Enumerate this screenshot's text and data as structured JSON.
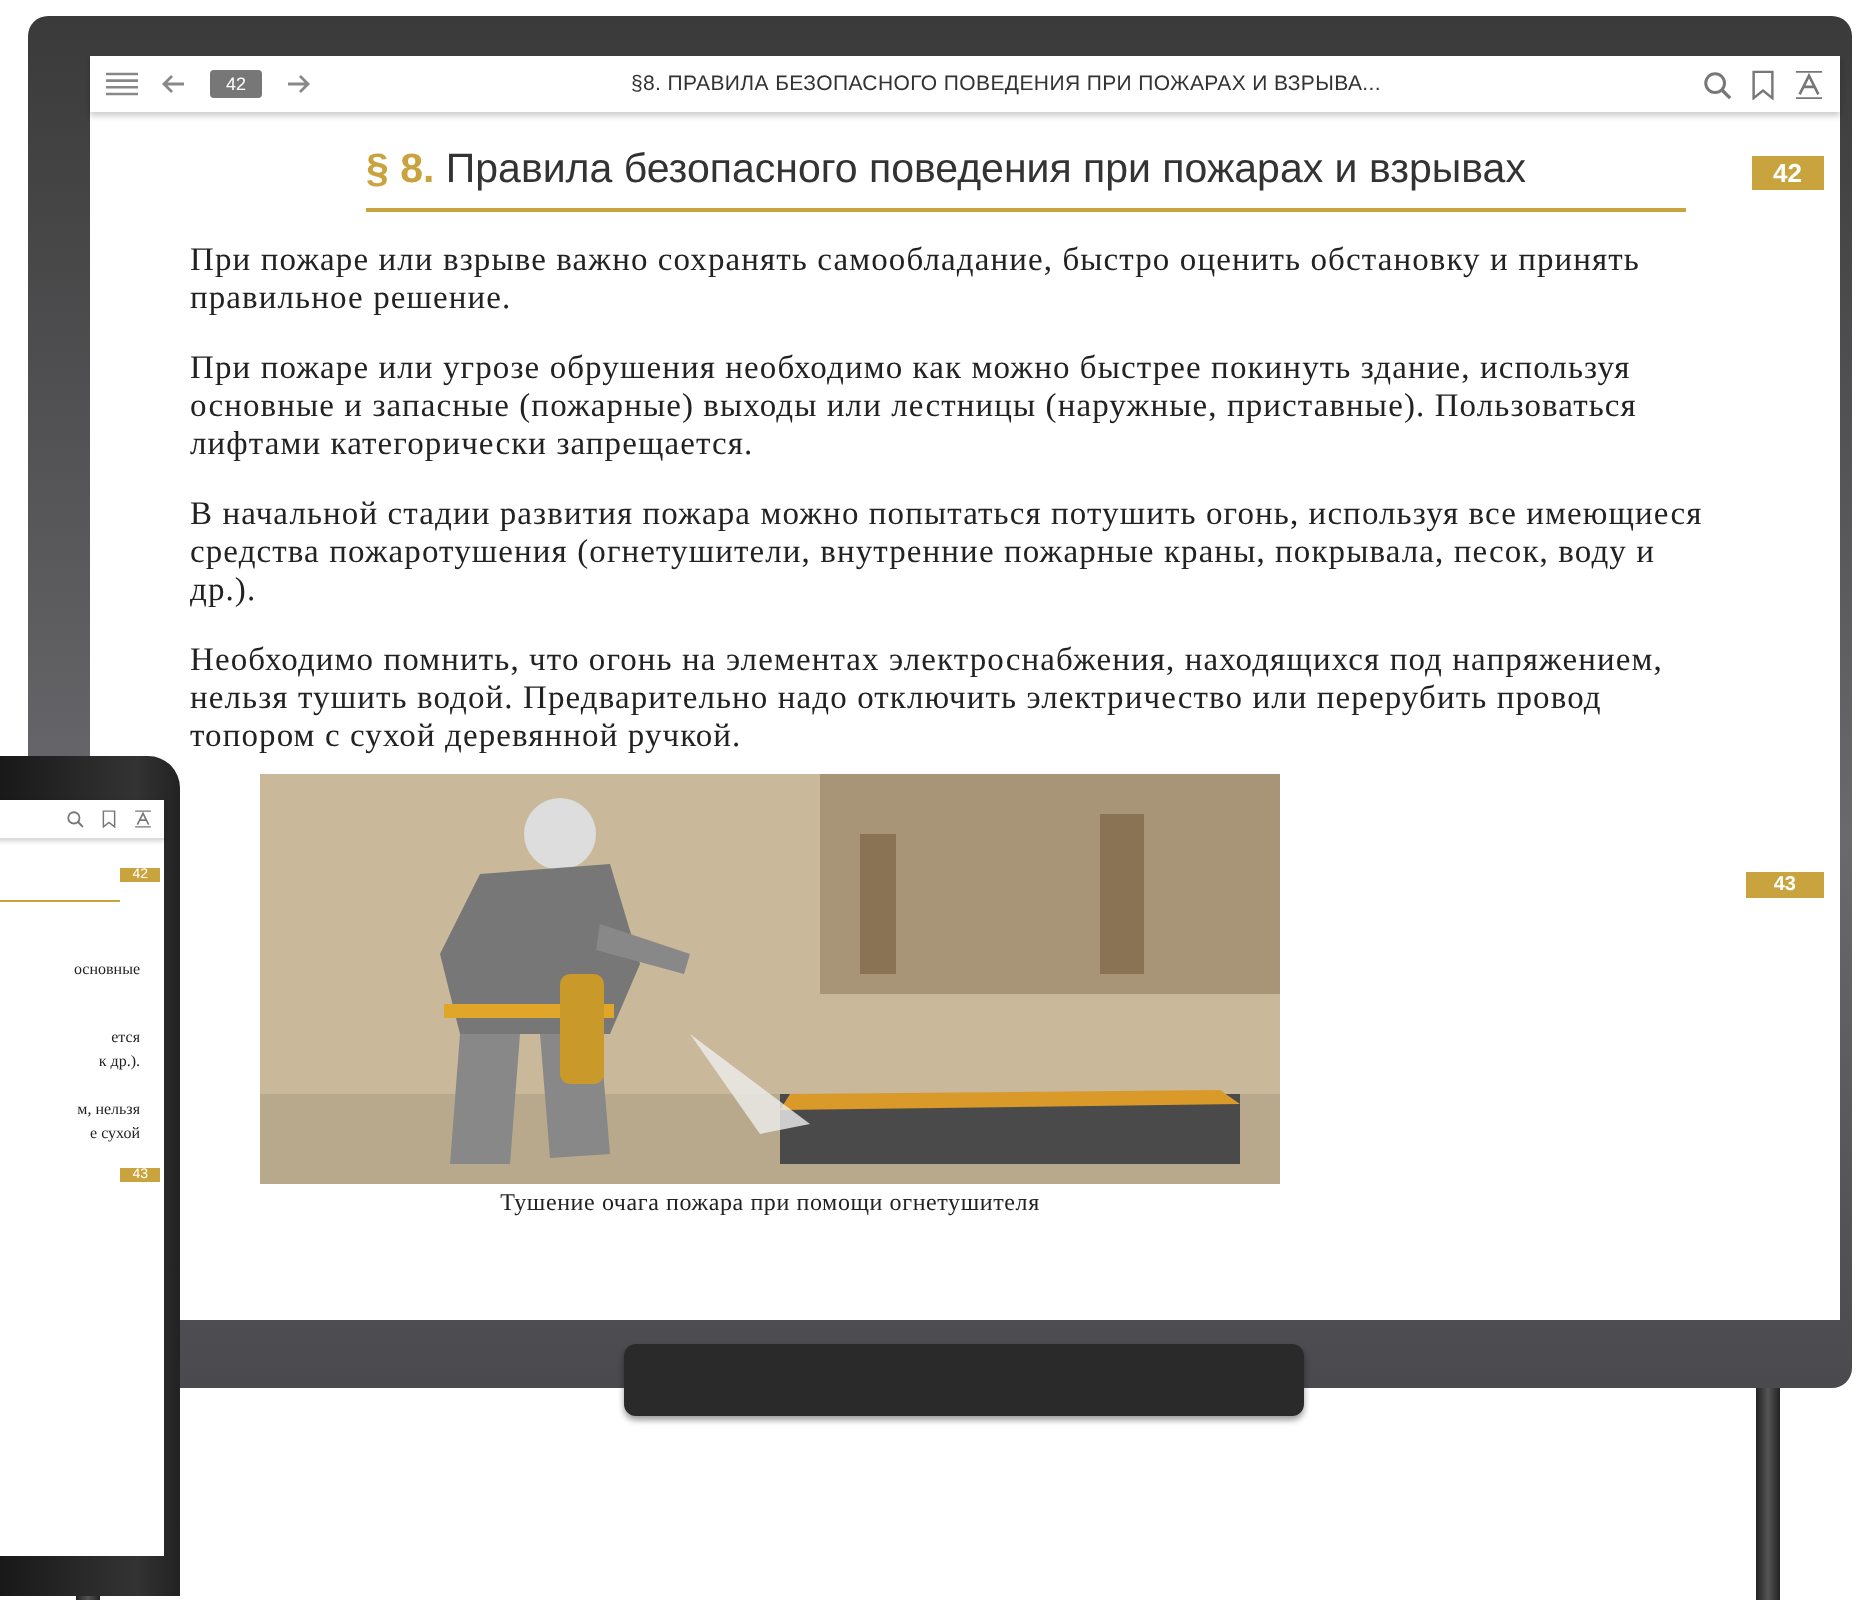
{
  "board": {
    "toolbar": {
      "page": "42",
      "title": "§8. ПРАВИЛА БЕЗОПАСНОГО ПОВЕДЕНИЯ ПРИ ПОЖАРАХ И ВЗРЫВА..."
    },
    "page_badge": "42",
    "heading": {
      "number": "§ 8.",
      "title": "Правила безопасного поведения при пожарах и взрывах"
    },
    "paragraphs": [
      "При пожаре или взрыве важно сохранять самообладание, быстро оценить обстановку и принять правильное решение.",
      "При пожаре или угрозе обрушения необходимо как можно быстрее покинуть здание, используя основные и запасные (пожарные) выходы или лестницы (наружные, приставные). Пользоваться лифтами категорически запрещается.",
      "В начальной стадии развития пожара можно попытаться потушить огонь, используя все имеющиеся средства пожаротушения (огнетушители, внутренние пожарные краны, покрывала, песок, воду и др.).",
      "Необходимо помнить, что огонь на элементах электроснабжения, находящихся под напряжением, нельзя тушить водой. Предварительно надо отключить электричество или перерубить провод топором с сухой деревянной ручкой."
    ],
    "next_page_badge": "43",
    "figure": {
      "kind": "picture",
      "caption": "Тушение очага пожара при помощи огнетушителя"
    }
  },
  "tablet": {
    "page_badge": "42",
    "fragments": [
      "основные",
      "ется",
      "к др.).",
      "м, нельзя",
      "е сухой"
    ],
    "next_page_badge": "43"
  }
}
